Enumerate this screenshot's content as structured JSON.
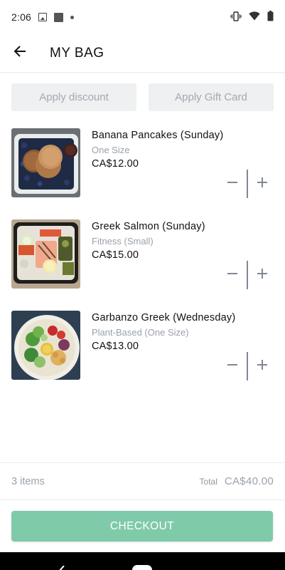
{
  "status_bar": {
    "time": "2:06",
    "icons": [
      "photo-icon",
      "square-icon",
      "dot-icon",
      "vibrate-icon",
      "wifi-icon",
      "battery-icon"
    ]
  },
  "header": {
    "back_icon": "arrow-left-icon",
    "title": "MY BAG"
  },
  "promo": {
    "discount_label": "Apply discount",
    "gift_card_label": "Apply Gift Card"
  },
  "items": [
    {
      "name": "Banana Pancakes (Sunday)",
      "variant": "One Size",
      "price": "CA$12.00",
      "image": "pancakes-with-blueberries"
    },
    {
      "name": "Greek Salmon (Sunday)",
      "variant": "Fitness (Small)",
      "price": "CA$15.00",
      "image": "salmon-salad-bowl"
    },
    {
      "name": "Garbanzo Greek (Wednesday)",
      "variant": "Plant-Based (One Size)",
      "price": "CA$13.00",
      "image": "chickpea-salad-bowl"
    }
  ],
  "summary": {
    "items_count": "3 items",
    "total_label": "Total",
    "total_value": "CA$40.00"
  },
  "checkout": {
    "label": "CHECKOUT"
  },
  "colors": {
    "accent": "#7fcaa9",
    "muted_text": "#9aa2ab",
    "promo_bg": "#eef0f1"
  }
}
